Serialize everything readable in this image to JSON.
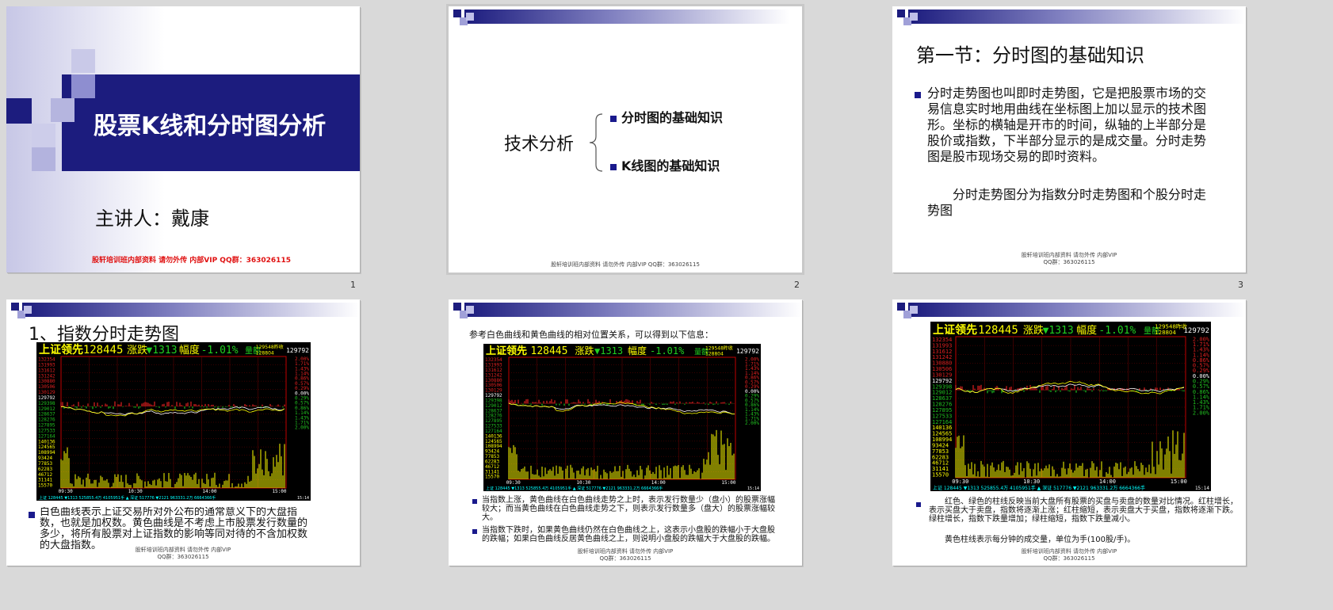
{
  "slides": [
    {
      "num": "1",
      "title": "股票K线和分时图分析",
      "presenter": "主讲人：戴康",
      "footer": "股轩培训班内部资料 请勿外传 内部VIP QQ群：363026115"
    },
    {
      "num": "2",
      "center": "技术分析",
      "items": [
        "分时图的基础知识",
        "K线图的基础知识"
      ],
      "footer": "股轩培训班内部资料 请勿外传 内部VIP QQ群：363026115"
    },
    {
      "num": "3",
      "title": "第一节：分时图的基础知识",
      "body": "分时走势图也叫即时走势图，它是把股票市场的交易信息实时地用曲线在坐标图上加以显示的技术图形。坐标的横轴是开市的时间，纵轴的上半部分是股价或指数，下半部分显示的是成交量。分时走势图是股市现场交易的即时资料。",
      "body2": "分时走势图分为指数分时走势图和个股分时走势图",
      "footer": "股轩培训班内部资料 请勿外传 内部VIP",
      "footer2": "QQ群：363026115"
    },
    {
      "num": "",
      "title": "1、指数分时走势图",
      "body": "白色曲线表示上证交易所对外公布的通常意义下的大盘指数，也就是加权数。黄色曲线是不考虑上市股票发行数量的多少，将所有股票对上证指数的影响等同对待的不含加权数的大盘指数。",
      "footer": "股轩培训班内部资料 请勿外传 内部VIP",
      "footer2": "QQ群：363026115"
    },
    {
      "num": "",
      "intro": "参考白色曲线和黄色曲线的相对位置关系，可以得到以下信息：",
      "b1": "当指数上涨，黄色曲线在白色曲线走势之上时，表示发行数量少（盘小）的股票涨幅较大；而当黄色曲线在白色曲线走势之下，则表示发行数量多（盘大）的股票涨幅较大。",
      "b2": "当指数下跌时，如果黄色曲线仍然在白色曲线之上，这表示小盘股的跌幅小于大盘股的跌幅；如果白色曲线反居黄色曲线之上，则说明小盘股的跌幅大于大盘股的跌幅。",
      "footer": "股轩培训班内部资料 请勿外传 内部VIP",
      "footer2": "QQ群：363026115"
    },
    {
      "num": "",
      "b1": "红色、绿色的柱线反映当前大盘所有股票的买盘与卖盘的数量对比情况。红柱增长，表示买盘大于卖盘，指数将逐渐上涨；红柱缩短，表示卖盘大于买盘，指数将逐渐下跌。绿柱增长，指数下跌量增加；绿柱缩短，指数下跌量减小。",
      "b2": "黄色柱线表示每分钟的成交量，单位为手(100股/手)。",
      "footer": "股轩培训班内部资料 请勿外传 内部VIP",
      "footer2": "QQ群：363026115"
    }
  ],
  "chart": {
    "title": "上证领先",
    "value": "128445",
    "change_label": "涨跌",
    "change": "▼1313",
    "pct_label": "幅度",
    "pct": "-1.01%",
    "tag": "量额",
    "side1": "129548昨收",
    "side2": "128804",
    "top_right": "129792",
    "left_ticks": [
      "132354",
      "131993",
      "131612",
      "131242",
      "130880",
      "130506",
      "130129",
      "129792",
      "129398",
      "129012",
      "128637",
      "128276",
      "127895",
      "127533",
      "127164",
      "140136",
      "124565",
      "108994",
      "93424",
      "77853",
      "62283",
      "46712",
      "31141",
      "15570"
    ],
    "right_ticks": [
      "2.00%",
      "1.71%",
      "1.43%",
      "1.14%",
      "0.86%",
      "0.57%",
      "0.29%",
      "0.00%",
      "0.29%",
      "0.57%",
      "0.86%",
      "1.14%",
      "1.43%",
      "1.71%",
      "2.00%"
    ],
    "time_ticks": [
      "09:30",
      "10:30",
      "14:00",
      "15:00"
    ],
    "status": "上证 128445 ▼1313 525855.4万 4105951手 ▲ 深证 517776 ▼2121 963331.2万 6664366手",
    "status_time": "15:14"
  },
  "colors": {
    "navy": "#1c1c7e",
    "accent": "#e01010",
    "up": "#e02020",
    "down": "#20c020",
    "vol": "#ffff00"
  }
}
